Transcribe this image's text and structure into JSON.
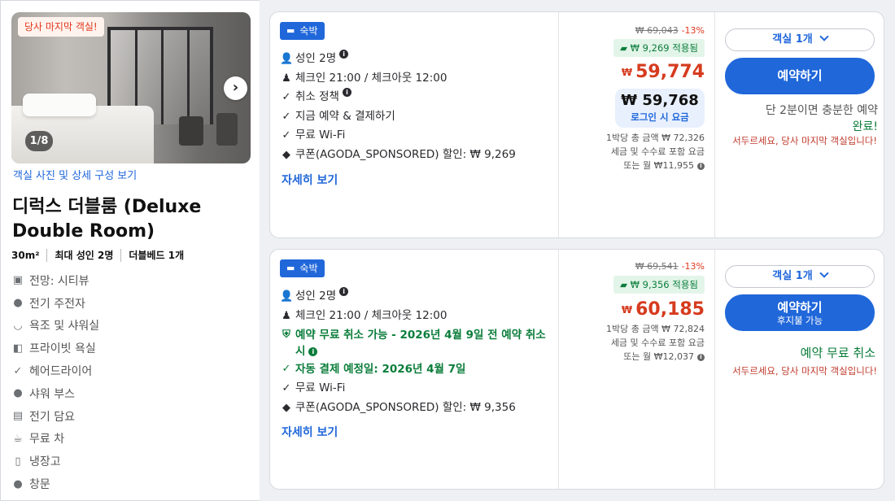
{
  "gallery": {
    "badge": "당사 마지막 객실!",
    "counter": "1/8",
    "link": "객실 사진 및 상세 구성 보기"
  },
  "room": {
    "title": "디럭스 더블룸 (Deluxe Double Room)",
    "specs": [
      "30m²",
      "최대 성인 2명",
      "더블베드 1개"
    ],
    "amenities": [
      {
        "icon": "city-view-icon",
        "label": "전망: 시티뷰"
      },
      {
        "icon": "kettle-icon",
        "label": "전기 주전자"
      },
      {
        "icon": "bathtub-icon",
        "label": "욕조 및 샤워실"
      },
      {
        "icon": "private-bathroom-icon",
        "label": "프라이빗 욕실"
      },
      {
        "icon": "check-icon",
        "label": "헤어드라이어"
      },
      {
        "icon": "shower-icon",
        "label": "샤워 부스"
      },
      {
        "icon": "blanket-icon",
        "label": "전기 담요"
      },
      {
        "icon": "tea-icon",
        "label": "무료 차"
      },
      {
        "icon": "fridge-icon",
        "label": "냉장고"
      },
      {
        "icon": "window-icon",
        "label": "창문"
      }
    ]
  },
  "offers": [
    {
      "tag": "숙박",
      "features": [
        {
          "icon": "person-icon",
          "text": "성인 2명",
          "info": true
        },
        {
          "icon": "checkin-icon",
          "text": "체크인 21:00 / 체크아웃 12:00"
        },
        {
          "icon": "check-icon",
          "text": "취소 정책",
          "info": true
        },
        {
          "icon": "check-icon",
          "text": "지금 예약 & 결제하기"
        },
        {
          "icon": "check-icon",
          "text": "무료 Wi-Fi"
        },
        {
          "icon": "coupon-tag-icon",
          "text": "쿠폰(AGODA_SPONSORED) 할인: ₩ 9,269"
        }
      ],
      "more": "자세히 보기",
      "old_price": "₩ 69,043",
      "discount": "-13%",
      "coupon": "₩ 9,269 적용됨",
      "currency": "₩",
      "price": "59,774",
      "login_price": "₩ 59,768",
      "login_label": "로그인 시 요금",
      "price_info": [
        "1박당 총 금액 ₩ 72,326",
        "세금 및 수수료 포함 요금",
        "또는 월 ₩11,955"
      ],
      "rooms_select": "객실 1개",
      "book": "예약하기",
      "quick_1": "단 2분이면 충분한 예약",
      "quick_2": "완료!",
      "hurry": "서두르세요, 당사 마지막 객실입니다!"
    },
    {
      "tag": "숙박",
      "features": [
        {
          "icon": "person-icon",
          "text": "성인 2명",
          "info": true
        },
        {
          "icon": "checkin-icon",
          "text": "체크인 21:00 / 체크아웃 12:00"
        },
        {
          "icon": "shield-check-icon",
          "text": "예약 무료 취소 가능 - 2026년 4월 9일 전 예약 취소 시",
          "info": true,
          "green": true
        },
        {
          "icon": "check-icon",
          "text": "자동 결제 예정일: 2026년 4월 7일",
          "green": true
        },
        {
          "icon": "check-icon",
          "text": "무료 Wi-Fi"
        },
        {
          "icon": "coupon-tag-icon",
          "text": "쿠폰(AGODA_SPONSORED) 할인: ₩ 9,356"
        }
      ],
      "more": "자세히 보기",
      "old_price": "₩ 69,541",
      "discount": "-13%",
      "coupon": "₩ 9,356 적용됨",
      "currency": "₩",
      "price": "60,185",
      "price_info": [
        "1박당 총 금액 ₩ 72,824",
        "세금 및 수수료 포함 요금",
        "또는 월 ₩12,037"
      ],
      "rooms_select": "객실 1개",
      "book": "예약하기",
      "book_sub": "후지불 가능",
      "free_cancel": "예약 무료 취소",
      "hurry": "서두르세요, 당사 마지막 객실입니다!"
    }
  ]
}
